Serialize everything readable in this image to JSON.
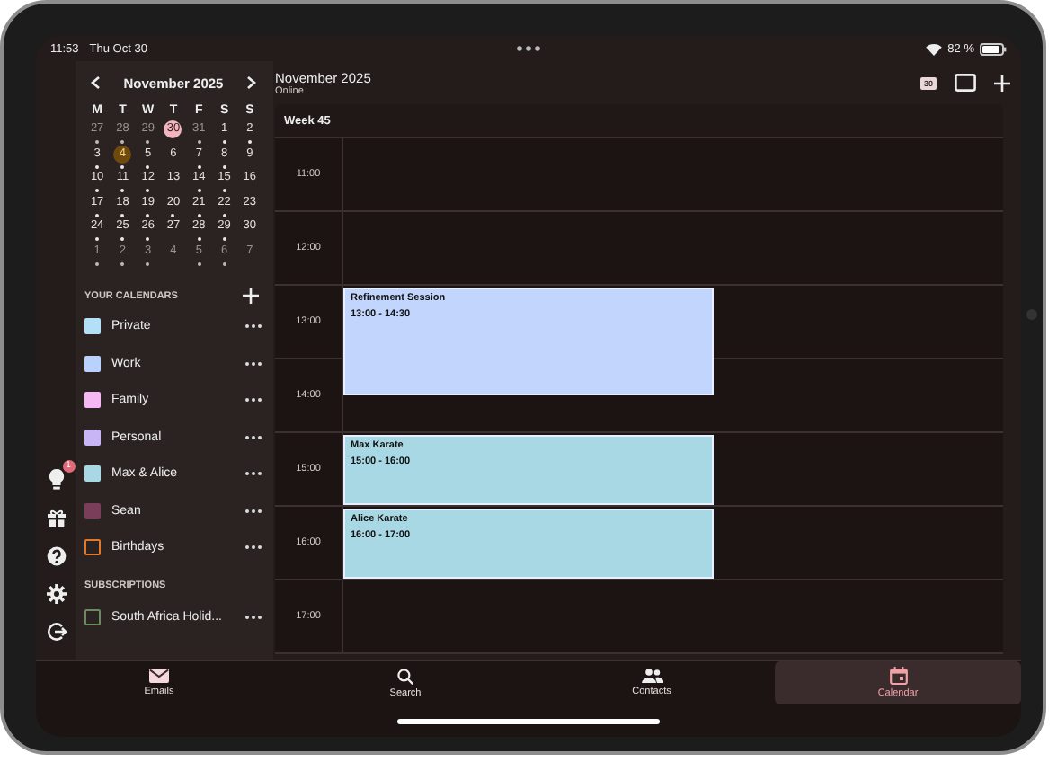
{
  "status_bar": {
    "time": "11:53",
    "date": "Thu Oct 30",
    "battery": "82 %"
  },
  "mini_calendar": {
    "title": "November 2025",
    "weekdays": [
      "M",
      "T",
      "W",
      "T",
      "F",
      "S",
      "S"
    ],
    "weeks": [
      [
        {
          "day": "27",
          "outside": true,
          "dot": true,
          "today": false,
          "selected": false
        },
        {
          "day": "28",
          "outside": true,
          "dot": true,
          "today": false,
          "selected": false
        },
        {
          "day": "29",
          "outside": true,
          "dot": true,
          "today": false,
          "selected": false
        },
        {
          "day": "30",
          "outside": true,
          "dot": false,
          "today": true,
          "selected": false
        },
        {
          "day": "31",
          "outside": true,
          "dot": true,
          "today": false,
          "selected": false
        },
        {
          "day": "1",
          "outside": false,
          "dot": true,
          "today": false,
          "selected": false
        },
        {
          "day": "2",
          "outside": false,
          "dot": true,
          "today": false,
          "selected": false
        }
      ],
      [
        {
          "day": "3",
          "outside": false,
          "dot": true,
          "today": false,
          "selected": false
        },
        {
          "day": "4",
          "outside": false,
          "dot": true,
          "today": false,
          "selected": true
        },
        {
          "day": "5",
          "outside": false,
          "dot": true,
          "today": false,
          "selected": false
        },
        {
          "day": "6",
          "outside": false,
          "dot": false,
          "today": false,
          "selected": false
        },
        {
          "day": "7",
          "outside": false,
          "dot": true,
          "today": false,
          "selected": false
        },
        {
          "day": "8",
          "outside": false,
          "dot": true,
          "today": false,
          "selected": false
        },
        {
          "day": "9",
          "outside": false,
          "dot": false,
          "today": false,
          "selected": false
        }
      ],
      [
        {
          "day": "10",
          "outside": false,
          "dot": true,
          "today": false,
          "selected": false
        },
        {
          "day": "11",
          "outside": false,
          "dot": true,
          "today": false,
          "selected": false
        },
        {
          "day": "12",
          "outside": false,
          "dot": true,
          "today": false,
          "selected": false
        },
        {
          "day": "13",
          "outside": false,
          "dot": false,
          "today": false,
          "selected": false
        },
        {
          "day": "14",
          "outside": false,
          "dot": true,
          "today": false,
          "selected": false
        },
        {
          "day": "15",
          "outside": false,
          "dot": true,
          "today": false,
          "selected": false
        },
        {
          "day": "16",
          "outside": false,
          "dot": false,
          "today": false,
          "selected": false
        }
      ],
      [
        {
          "day": "17",
          "outside": false,
          "dot": true,
          "today": false,
          "selected": false
        },
        {
          "day": "18",
          "outside": false,
          "dot": true,
          "today": false,
          "selected": false
        },
        {
          "day": "19",
          "outside": false,
          "dot": true,
          "today": false,
          "selected": false
        },
        {
          "day": "20",
          "outside": false,
          "dot": true,
          "today": false,
          "selected": false
        },
        {
          "day": "21",
          "outside": false,
          "dot": true,
          "today": false,
          "selected": false
        },
        {
          "day": "22",
          "outside": false,
          "dot": true,
          "today": false,
          "selected": false
        },
        {
          "day": "23",
          "outside": false,
          "dot": false,
          "today": false,
          "selected": false
        }
      ],
      [
        {
          "day": "24",
          "outside": false,
          "dot": true,
          "today": false,
          "selected": false
        },
        {
          "day": "25",
          "outside": false,
          "dot": true,
          "today": false,
          "selected": false
        },
        {
          "day": "26",
          "outside": false,
          "dot": true,
          "today": false,
          "selected": false
        },
        {
          "day": "27",
          "outside": false,
          "dot": false,
          "today": false,
          "selected": false
        },
        {
          "day": "28",
          "outside": false,
          "dot": true,
          "today": false,
          "selected": false
        },
        {
          "day": "29",
          "outside": false,
          "dot": true,
          "today": false,
          "selected": false
        },
        {
          "day": "30",
          "outside": false,
          "dot": false,
          "today": false,
          "selected": false
        }
      ],
      [
        {
          "day": "1",
          "outside": true,
          "dot": true,
          "today": false,
          "selected": false
        },
        {
          "day": "2",
          "outside": true,
          "dot": true,
          "today": false,
          "selected": false
        },
        {
          "day": "3",
          "outside": true,
          "dot": true,
          "today": false,
          "selected": false
        },
        {
          "day": "4",
          "outside": true,
          "dot": false,
          "today": false,
          "selected": false
        },
        {
          "day": "5",
          "outside": true,
          "dot": true,
          "today": false,
          "selected": false
        },
        {
          "day": "6",
          "outside": true,
          "dot": true,
          "today": false,
          "selected": false
        },
        {
          "day": "7",
          "outside": true,
          "dot": false,
          "today": false,
          "selected": false
        }
      ]
    ]
  },
  "calendars": {
    "heading": "YOUR CALENDARS",
    "items": [
      {
        "name": "Private",
        "color": "#b3e0f7",
        "kind": "filled"
      },
      {
        "name": "Work",
        "color": "#b9d1fb",
        "kind": "filled"
      },
      {
        "name": "Family",
        "color": "#f5b8f5",
        "kind": "filled"
      },
      {
        "name": "Personal",
        "color": "#c7b5f6",
        "kind": "filled"
      },
      {
        "name": "Max & Alice",
        "color": "#a8d8e4",
        "kind": "filled"
      },
      {
        "name": "Sean",
        "color": "#7a3d5a",
        "kind": "filled"
      },
      {
        "name": "Birthdays",
        "color": "#e07a2a",
        "kind": "outline"
      }
    ]
  },
  "subscriptions": {
    "heading": "SUBSCRIPTIONS",
    "items": [
      {
        "name": "South Africa Holid...",
        "color": "#6a8a62",
        "kind": "outline"
      }
    ]
  },
  "rail": {
    "badge": "1"
  },
  "header": {
    "title": "November 2025",
    "subtitle": "Online",
    "date_icon": "30"
  },
  "week": {
    "label": "Week 45",
    "hours": [
      "11:00",
      "12:00",
      "13:00",
      "14:00",
      "15:00",
      "16:00",
      "17:00"
    ],
    "events": [
      {
        "title": "Refinement Session",
        "time": "13:00 - 14:30",
        "color": "#c2d5fd"
      },
      {
        "title": "Max Karate",
        "time": "15:00 - 16:00",
        "color": "#a8d8e4"
      },
      {
        "title": "Alice Karate",
        "time": "16:00 - 17:00",
        "color": "#a8d8e4"
      }
    ]
  },
  "tabs": [
    {
      "label": "Emails",
      "kind": "mail",
      "selected": false
    },
    {
      "label": "Search",
      "kind": "search",
      "selected": false
    },
    {
      "label": "Contacts",
      "kind": "contacts",
      "selected": false
    },
    {
      "label": "Calendar",
      "kind": "calendar",
      "selected": true
    }
  ]
}
